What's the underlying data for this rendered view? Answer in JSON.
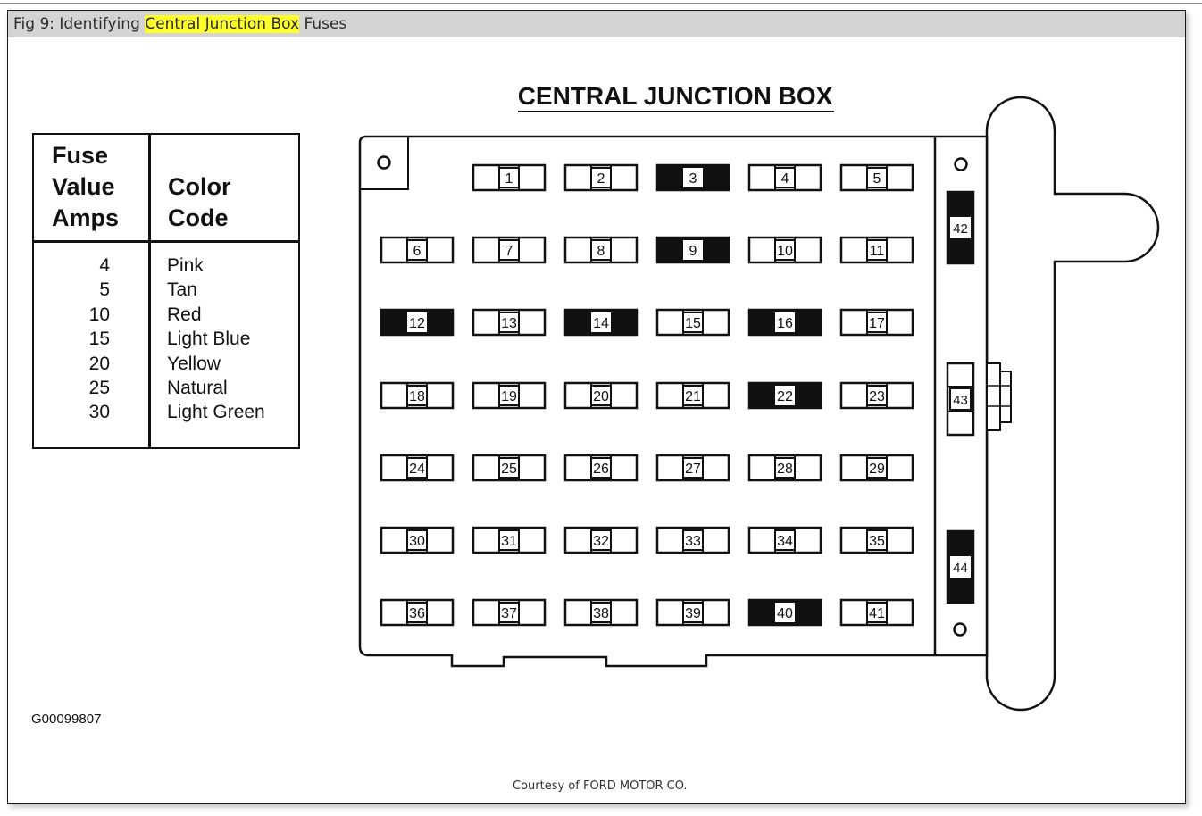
{
  "caption": {
    "prefix": "Fig 9: Identifying ",
    "highlight": "Central Junction Box",
    "suffix": " Fuses",
    "highlight_color": "#ffff2a"
  },
  "legend": {
    "header_amps": [
      "Fuse",
      "Value",
      "Amps"
    ],
    "header_color": [
      "Color",
      "Code"
    ],
    "rows": [
      {
        "amps": "4",
        "color": "Pink"
      },
      {
        "amps": "5",
        "color": "Tan"
      },
      {
        "amps": "10",
        "color": "Red"
      },
      {
        "amps": "15",
        "color": "Light Blue"
      },
      {
        "amps": "20",
        "color": "Yellow"
      },
      {
        "amps": "25",
        "color": "Natural"
      },
      {
        "amps": "30",
        "color": "Light Green"
      }
    ]
  },
  "diagram": {
    "title": "CENTRAL JUNCTION BOX",
    "fuse_rows": [
      [
        null,
        {
          "n": "1",
          "dark": false
        },
        {
          "n": "2",
          "dark": false
        },
        {
          "n": "3",
          "dark": true
        },
        {
          "n": "4",
          "dark": false
        },
        {
          "n": "5",
          "dark": false
        }
      ],
      [
        {
          "n": "6",
          "dark": false
        },
        {
          "n": "7",
          "dark": false
        },
        {
          "n": "8",
          "dark": false
        },
        {
          "n": "9",
          "dark": true
        },
        {
          "n": "10",
          "dark": false
        },
        {
          "n": "11",
          "dark": false
        }
      ],
      [
        {
          "n": "12",
          "dark": true
        },
        {
          "n": "13",
          "dark": false
        },
        {
          "n": "14",
          "dark": true
        },
        {
          "n": "15",
          "dark": false
        },
        {
          "n": "16",
          "dark": true
        },
        {
          "n": "17",
          "dark": false
        }
      ],
      [
        {
          "n": "18",
          "dark": false
        },
        {
          "n": "19",
          "dark": false
        },
        {
          "n": "20",
          "dark": false
        },
        {
          "n": "21",
          "dark": false
        },
        {
          "n": "22",
          "dark": true
        },
        {
          "n": "23",
          "dark": false
        }
      ],
      [
        {
          "n": "24",
          "dark": false
        },
        {
          "n": "25",
          "dark": false
        },
        {
          "n": "26",
          "dark": false
        },
        {
          "n": "27",
          "dark": false
        },
        {
          "n": "28",
          "dark": false
        },
        {
          "n": "29",
          "dark": false
        }
      ],
      [
        {
          "n": "30",
          "dark": false
        },
        {
          "n": "31",
          "dark": false
        },
        {
          "n": "32",
          "dark": false
        },
        {
          "n": "33",
          "dark": false
        },
        {
          "n": "34",
          "dark": false
        },
        {
          "n": "35",
          "dark": false
        }
      ],
      [
        {
          "n": "36",
          "dark": false
        },
        {
          "n": "37",
          "dark": false
        },
        {
          "n": "38",
          "dark": false
        },
        {
          "n": "39",
          "dark": false
        },
        {
          "n": "40",
          "dark": true
        },
        {
          "n": "41",
          "dark": false
        }
      ]
    ],
    "vertical_fuses": [
      {
        "n": "42",
        "dark": true
      },
      {
        "n": "43",
        "dark": false
      },
      {
        "n": "44",
        "dark": true
      }
    ]
  },
  "figure_id": "G00099807",
  "courtesy": "Courtesy of FORD MOTOR CO."
}
